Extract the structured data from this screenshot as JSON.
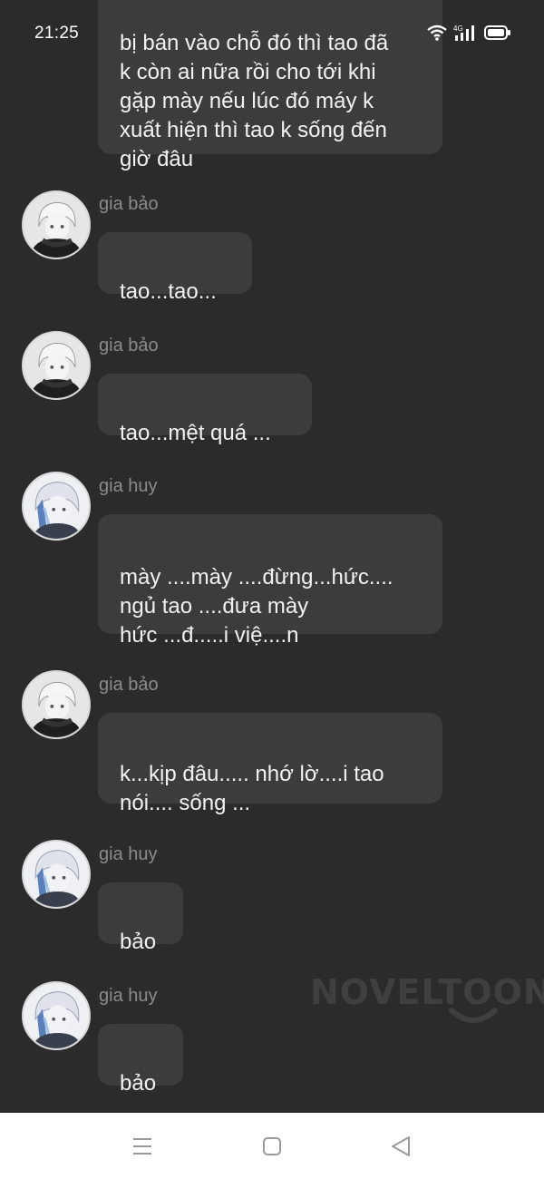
{
  "status_bar": {
    "time": "21:25",
    "icons": [
      "wifi-icon",
      "4g-signal-icon",
      "battery-icon"
    ]
  },
  "messages": [
    {
      "sender": "",
      "text": "bị bán vào chỗ đó thì tao đã\nk còn ai nữa rồi cho tới khi\ngặp mày nếu lúc đó máy k\nxuất hiện thì tao k sống đến\ngiờ đâu"
    },
    {
      "sender": "gia bảo",
      "avatar": "avatar-gia-bao",
      "text": "tao...tao..."
    },
    {
      "sender": "gia bảo",
      "avatar": "avatar-gia-bao",
      "text": "tao...mệt quá ..."
    },
    {
      "sender": "gia huy",
      "avatar": "avatar-gia-huy",
      "text": "mày ....mày ....đừng...hức....\nngủ tao ....đưa mày\nhức ...đ.....i việ....n"
    },
    {
      "sender": "gia bảo",
      "avatar": "avatar-gia-bao",
      "text": "k...kịp đâu..... nhớ lờ....i tao\nnói.... sống ..."
    },
    {
      "sender": "gia huy",
      "avatar": "avatar-gia-huy",
      "text": "bảo"
    },
    {
      "sender": "gia huy",
      "avatar": "avatar-gia-huy",
      "text": "bảo"
    }
  ],
  "watermark": "NOVELTOON",
  "nav_bar": {
    "buttons": [
      "menu-icon",
      "home-icon",
      "back-icon"
    ]
  },
  "colors": {
    "background": "#2b2b2b",
    "bubble": "#3c3c3c",
    "text": "#f2f2f2",
    "sender": "#8b8b8b",
    "nav_bar": "#ffffff"
  }
}
